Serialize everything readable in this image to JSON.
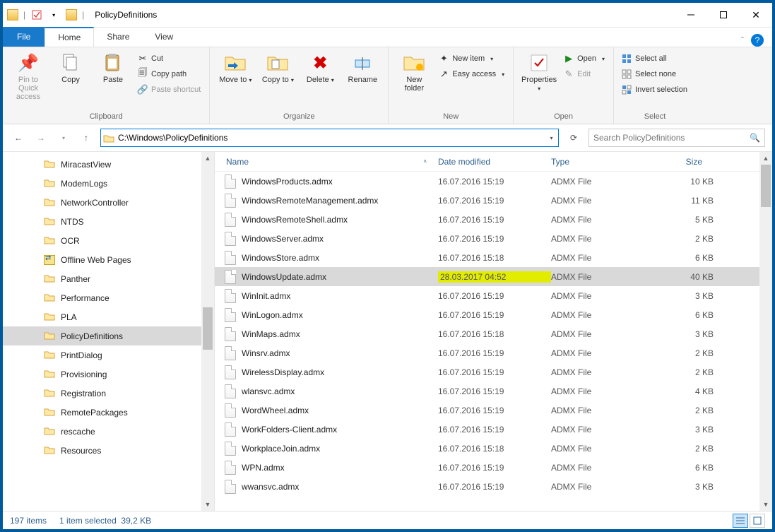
{
  "title": "PolicyDefinitions",
  "tabs": {
    "file": "File",
    "home": "Home",
    "share": "Share",
    "view": "View"
  },
  "ribbon": {
    "clipboard": {
      "label": "Clipboard",
      "pin": "Pin to Quick access",
      "copy": "Copy",
      "paste": "Paste",
      "cut": "Cut",
      "copypath": "Copy path",
      "pasteshortcut": "Paste shortcut"
    },
    "organize": {
      "label": "Organize",
      "moveto": "Move to",
      "copyto": "Copy to",
      "delete": "Delete",
      "rename": "Rename"
    },
    "new": {
      "label": "New",
      "newfolder": "New folder",
      "newitem": "New item",
      "easyaccess": "Easy access"
    },
    "open": {
      "label": "Open",
      "properties": "Properties",
      "open": "Open",
      "edit": "Edit"
    },
    "select": {
      "label": "Select",
      "selectall": "Select all",
      "selectnone": "Select none",
      "invert": "Invert selection"
    }
  },
  "address": "C:\\Windows\\PolicyDefinitions",
  "search_placeholder": "Search PolicyDefinitions",
  "tree": [
    {
      "label": "MiracastView"
    },
    {
      "label": "ModemLogs"
    },
    {
      "label": "NetworkController"
    },
    {
      "label": "NTDS"
    },
    {
      "label": "OCR"
    },
    {
      "label": "Offline Web Pages",
      "icon": "offline"
    },
    {
      "label": "Panther"
    },
    {
      "label": "Performance"
    },
    {
      "label": "PLA"
    },
    {
      "label": "PolicyDefinitions",
      "selected": true
    },
    {
      "label": "PrintDialog"
    },
    {
      "label": "Provisioning"
    },
    {
      "label": "Registration"
    },
    {
      "label": "RemotePackages"
    },
    {
      "label": "rescache"
    },
    {
      "label": "Resources"
    }
  ],
  "columns": {
    "name": "Name",
    "date": "Date modified",
    "type": "Type",
    "size": "Size"
  },
  "files": [
    {
      "name": "WindowsProducts.admx",
      "date": "16.07.2016 15:19",
      "type": "ADMX File",
      "size": "10 KB"
    },
    {
      "name": "WindowsRemoteManagement.admx",
      "date": "16.07.2016 15:19",
      "type": "ADMX File",
      "size": "11 KB"
    },
    {
      "name": "WindowsRemoteShell.admx",
      "date": "16.07.2016 15:19",
      "type": "ADMX File",
      "size": "5 KB"
    },
    {
      "name": "WindowsServer.admx",
      "date": "16.07.2016 15:19",
      "type": "ADMX File",
      "size": "2 KB"
    },
    {
      "name": "WindowsStore.admx",
      "date": "16.07.2016 15:18",
      "type": "ADMX File",
      "size": "6 KB"
    },
    {
      "name": "WindowsUpdate.admx",
      "date": "28.03.2017 04:52",
      "type": "ADMX File",
      "size": "40 KB",
      "selected": true,
      "hl": true
    },
    {
      "name": "WinInit.admx",
      "date": "16.07.2016 15:19",
      "type": "ADMX File",
      "size": "3 KB"
    },
    {
      "name": "WinLogon.admx",
      "date": "16.07.2016 15:19",
      "type": "ADMX File",
      "size": "6 KB"
    },
    {
      "name": "WinMaps.admx",
      "date": "16.07.2016 15:18",
      "type": "ADMX File",
      "size": "3 KB"
    },
    {
      "name": "Winsrv.admx",
      "date": "16.07.2016 15:19",
      "type": "ADMX File",
      "size": "2 KB"
    },
    {
      "name": "WirelessDisplay.admx",
      "date": "16.07.2016 15:19",
      "type": "ADMX File",
      "size": "2 KB"
    },
    {
      "name": "wlansvc.admx",
      "date": "16.07.2016 15:19",
      "type": "ADMX File",
      "size": "4 KB"
    },
    {
      "name": "WordWheel.admx",
      "date": "16.07.2016 15:19",
      "type": "ADMX File",
      "size": "2 KB"
    },
    {
      "name": "WorkFolders-Client.admx",
      "date": "16.07.2016 15:19",
      "type": "ADMX File",
      "size": "3 KB"
    },
    {
      "name": "WorkplaceJoin.admx",
      "date": "16.07.2016 15:18",
      "type": "ADMX File",
      "size": "2 KB"
    },
    {
      "name": "WPN.admx",
      "date": "16.07.2016 15:19",
      "type": "ADMX File",
      "size": "6 KB"
    },
    {
      "name": "wwansvc.admx",
      "date": "16.07.2016 15:19",
      "type": "ADMX File",
      "size": "3 KB"
    }
  ],
  "status": {
    "items": "197 items",
    "selected": "1 item selected",
    "size": "39,2 KB"
  }
}
